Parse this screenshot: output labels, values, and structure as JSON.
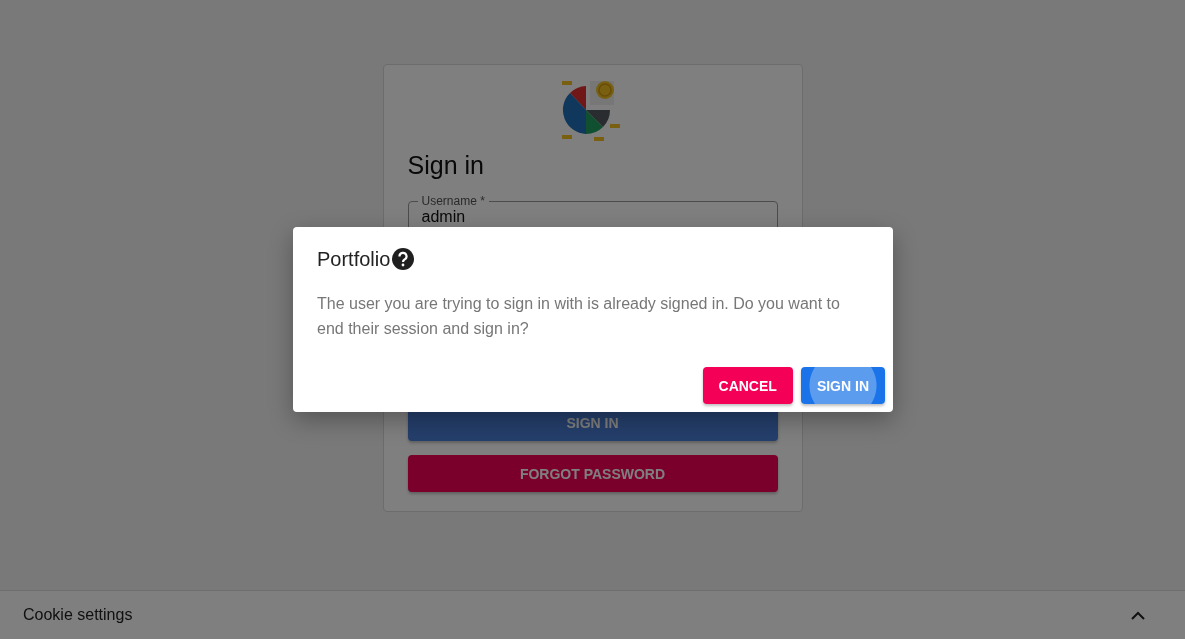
{
  "login": {
    "title": "Sign in",
    "username": {
      "label": "Username *",
      "value": "admin"
    },
    "buttons": [
      {
        "label": "SIGN IN",
        "kind": "primary"
      },
      {
        "label": "FORGOT PASSWORD",
        "kind": "secondary"
      }
    ]
  },
  "dialog": {
    "title": "Portfolio",
    "message": "The user you are trying to sign in with is already signed in. Do you want to end their session and sign in?",
    "buttons": [
      {
        "label": "CANCEL",
        "kind": "secondary"
      },
      {
        "label": "SIGN IN",
        "kind": "primary"
      }
    ]
  },
  "cookie_bar": {
    "label": "Cookie settings",
    "expanded": false
  }
}
